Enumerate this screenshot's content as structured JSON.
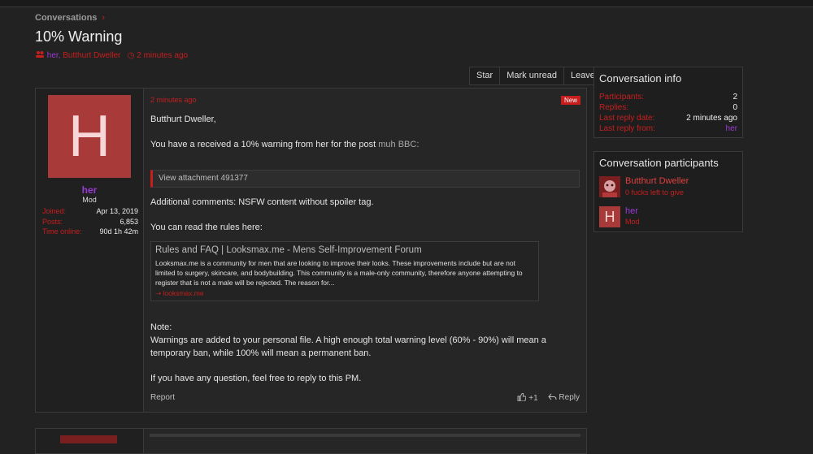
{
  "breadcrumb": {
    "label": "Conversations",
    "chevron": "›"
  },
  "page": {
    "title": "10% Warning"
  },
  "meta": {
    "icon": "users-icon",
    "participant1": "her,",
    "participant2": "Butthurt Dweller",
    "clock_icon": "◷",
    "time": "2 minutes ago"
  },
  "actions": {
    "star": "Star",
    "mark_unread": "Mark unread",
    "leave": "Leave"
  },
  "message": {
    "author": {
      "avatar_letter": "H",
      "name": "her",
      "title": "Mod",
      "stats": [
        {
          "label": "Joined:",
          "value": "Apr 13, 2019"
        },
        {
          "label": "Posts:",
          "value": "6,853"
        },
        {
          "label": "Time online:",
          "value": "90d 1h 42m"
        }
      ]
    },
    "timestamp": "2 minutes ago",
    "badge": "New",
    "greeting": "Butthurt Dweller,",
    "warning_text": "You have a received a 10% warning from her for the post ",
    "warning_link": "muh BBC:",
    "attachment": "View attachment 491377",
    "comments": "Additional comments: NSFW content without spoiler tag.",
    "rules_intro": "You can read the rules here:",
    "unfurl": {
      "title": "Rules and FAQ | Looksmax.me - Mens Self-Improvement Forum",
      "desc": "Looksmax.me is a community for men that are looking to improve their looks. These improvements include but are not limited to surgery, skincare, and bodybuilding. This community is a male-only community, therefore anyone attempting to register that is not a male will be rejected. The reason for...",
      "host": "looksmax.me"
    },
    "note_label": "Note:",
    "note_line1": "Warnings are added to your personal file. A high enough total warning level (60% - 90%) will mean a",
    "note_line2": "temporary ban, while 100% will mean a permanent ban.",
    "question": "If you have any question, feel free to reply to this PM.",
    "report": "Report",
    "like_count": "+1",
    "reply": "Reply"
  },
  "conversation_info": {
    "title": "Conversation info",
    "rows": [
      {
        "label": "Participants:",
        "value": "2"
      },
      {
        "label": "Replies:",
        "value": "0"
      },
      {
        "label": "Last reply date:",
        "value": "2 minutes ago"
      },
      {
        "label": "Last reply from:",
        "value": "her"
      }
    ]
  },
  "participants": {
    "title": "Conversation participants",
    "list": [
      {
        "name": "Butthurt Dweller",
        "sub": "0 fucks left to give",
        "avatar": ""
      },
      {
        "name": "her",
        "sub": "Mod",
        "avatar": "H"
      }
    ]
  },
  "colors": {
    "accent": "#c81e1e",
    "mod_name": "#9a3ad6",
    "bg": "#222222",
    "panel": "#1e1e1e"
  }
}
